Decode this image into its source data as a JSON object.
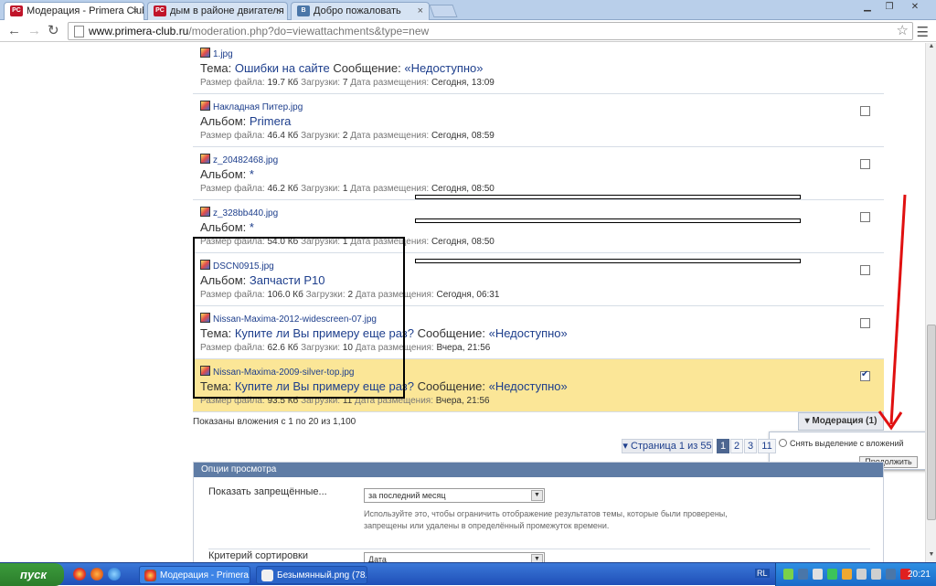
{
  "browser": {
    "tabs": [
      {
        "title": "Модерация - Primera Club",
        "fav": "PC",
        "fav_color": "#c0142a"
      },
      {
        "title": "дым в районе двигателя - ",
        "fav": "PC",
        "fav_color": "#c0142a"
      },
      {
        "title": "Добро пожаловать",
        "fav": "В",
        "fav_color": "#4a76a8"
      }
    ],
    "url_host": "www.primera-club.ru",
    "url_path": "/moderation.php?do=viewattachments&type=new"
  },
  "attachments": [
    {
      "file": "1.jpg",
      "ctx_label": "Тема:",
      "ctx_link": "Ошибки на сайте",
      "msg_label": "Сообщение:",
      "msg_link": "«Недоступно»",
      "size_label": "Размер файла:",
      "size": "19.7 Кб",
      "dl_label": "Загрузки:",
      "downloads": "7",
      "date_label": "Дата размещения:",
      "date": "Сегодня, 13:09",
      "checked": false,
      "has_checkbox": false
    },
    {
      "file": "Накладная Питер.jpg",
      "ctx_label": "Альбом:",
      "ctx_link": "Primera",
      "msg_label": "",
      "msg_link": "",
      "size_label": "Размер файла:",
      "size": "46.4 Кб",
      "dl_label": "Загрузки:",
      "downloads": "2",
      "date_label": "Дата размещения:",
      "date": "Сегодня, 08:59",
      "checked": false,
      "has_checkbox": true
    },
    {
      "file": "z_20482468.jpg",
      "ctx_label": "Альбом:",
      "ctx_link": "*",
      "msg_label": "",
      "msg_link": "",
      "size_label": "Размер файла:",
      "size": "46.2 Кб",
      "dl_label": "Загрузки:",
      "downloads": "1",
      "date_label": "Дата размещения:",
      "date": "Сегодня, 08:50",
      "checked": false,
      "has_checkbox": true
    },
    {
      "file": "z_328bb440.jpg",
      "ctx_label": "Альбом:",
      "ctx_link": "*",
      "msg_label": "",
      "msg_link": "",
      "size_label": "Размер файла:",
      "size": "54.0 Кб",
      "dl_label": "Загрузки:",
      "downloads": "1",
      "date_label": "Дата размещения:",
      "date": "Сегодня, 08:50",
      "checked": false,
      "has_checkbox": true
    },
    {
      "file": "DSCN0915.jpg",
      "ctx_label": "Альбом:",
      "ctx_link": "Запчасти P10",
      "msg_label": "",
      "msg_link": "",
      "size_label": "Размер файла:",
      "size": "106.0 Кб",
      "dl_label": "Загрузки:",
      "downloads": "2",
      "date_label": "Дата размещения:",
      "date": "Сегодня, 06:31",
      "checked": false,
      "has_checkbox": true
    },
    {
      "file": "Nissan-Maxima-2012-widescreen-07.jpg",
      "ctx_label": "Тема:",
      "ctx_link": "Купите ли Вы примеру еще раз?",
      "msg_label": "Сообщение:",
      "msg_link": "«Недоступно»",
      "size_label": "Размер файла:",
      "size": "62.6 Кб",
      "dl_label": "Загрузки:",
      "downloads": "10",
      "date_label": "Дата размещения:",
      "date": "Вчера, 21:56",
      "checked": false,
      "has_checkbox": true
    },
    {
      "file": "Nissan-Maxima-2009-silver-top.jpg",
      "ctx_label": "Тема:",
      "ctx_link": "Купите ли Вы примеру еще раз?",
      "msg_label": "Сообщение:",
      "msg_link": "«Недоступно»",
      "size_label": "Размер файла:",
      "size": "93.5 Кб",
      "dl_label": "Загрузки:",
      "downloads": "11",
      "date_label": "Дата размещения:",
      "date": "Вчера, 21:56",
      "checked": true,
      "has_checkbox": true
    }
  ],
  "summary": "Показаны вложения с 1 по 20 из 1,100",
  "moderation": {
    "button": "Модерация (1)",
    "option": "Снять выделение с вложений",
    "go": "Продолжить"
  },
  "pager": {
    "label": "Страница 1 из 55",
    "pages": [
      "1",
      "2",
      "3",
      "11"
    ],
    "current": "1"
  },
  "view_options": {
    "title": "Опции просмотра",
    "show_banned_label": "Показать запрещённые...",
    "show_banned_value": "за последний месяц",
    "hint": "Используйте это, чтобы ограничить отображение результатов темы, которые были проверены, запрещены или удалены в определённый промежуток времени.",
    "sort_label": "Критерий сортировки",
    "sort_value": "Дата"
  },
  "taskbar": {
    "start": "пуск",
    "tasks": [
      "Модерация - Primera...",
      "Безымянный.png (78..."
    ],
    "lang": "RL",
    "clock": "20:21"
  },
  "colors": {
    "highlight": "#fbe697",
    "link": "#1d3e8c",
    "annotation_arrow": "#e01010"
  }
}
